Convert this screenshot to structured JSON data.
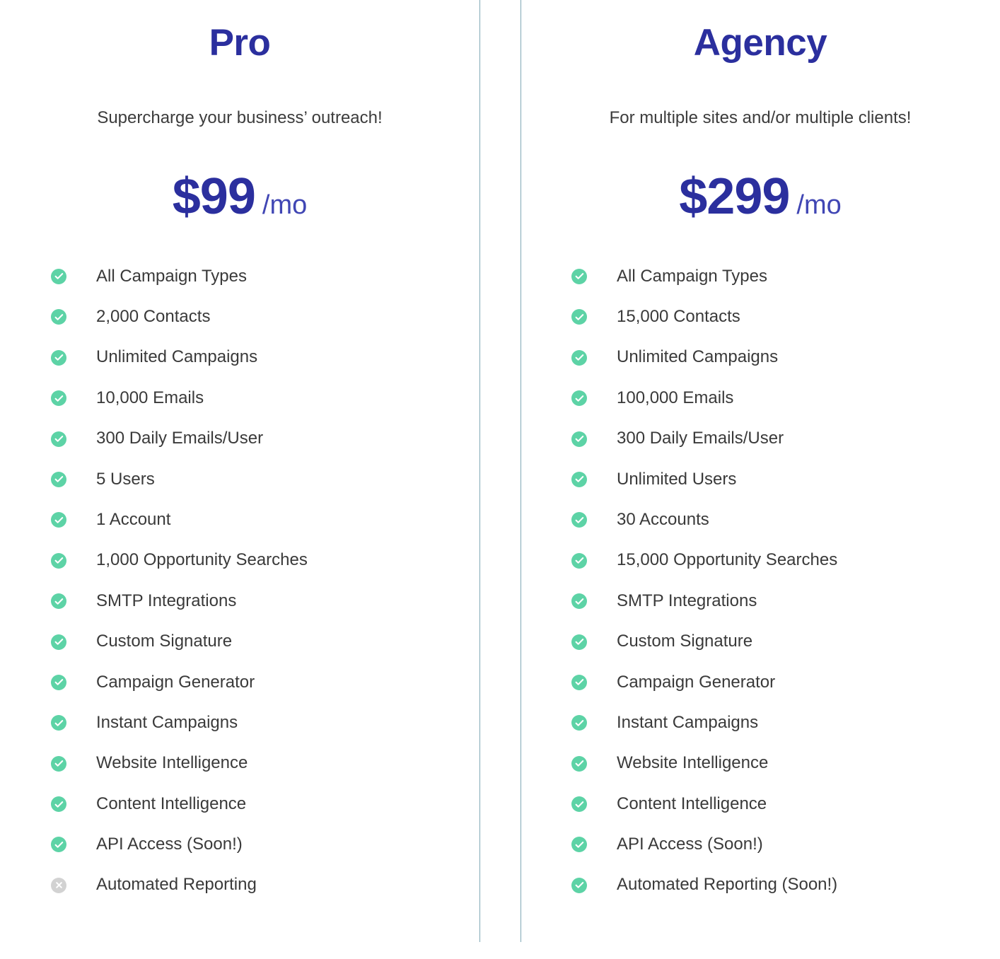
{
  "colors": {
    "title": "#2b2f9e",
    "price": "#2b2f9e",
    "period": "#4046b4",
    "feature_text": "#3a3a3a",
    "check_circle": "#5dd3a6",
    "cross_circle": "#d2d2d2",
    "divider": "#7fa8b5",
    "background": "#ffffff"
  },
  "plans": [
    {
      "name": "Pro",
      "tagline": "Supercharge your business’ outreach!",
      "price": "$99",
      "period": "/mo",
      "features": [
        {
          "label": "All Campaign Types",
          "included": true,
          "icon": "check-circle-icon"
        },
        {
          "label": "2,000 Contacts",
          "included": true,
          "icon": "check-circle-icon"
        },
        {
          "label": "Unlimited Campaigns",
          "included": true,
          "icon": "check-circle-icon"
        },
        {
          "label": "10,000 Emails",
          "included": true,
          "icon": "check-circle-icon"
        },
        {
          "label": "300 Daily Emails/User",
          "included": true,
          "icon": "check-circle-icon"
        },
        {
          "label": "5 Users",
          "included": true,
          "icon": "check-circle-icon"
        },
        {
          "label": "1 Account",
          "included": true,
          "icon": "check-circle-icon"
        },
        {
          "label": "1,000 Opportunity Searches",
          "included": true,
          "icon": "check-circle-icon"
        },
        {
          "label": "SMTP Integrations",
          "included": true,
          "icon": "check-circle-icon"
        },
        {
          "label": "Custom Signature",
          "included": true,
          "icon": "check-circle-icon"
        },
        {
          "label": "Campaign Generator",
          "included": true,
          "icon": "check-circle-icon"
        },
        {
          "label": "Instant Campaigns",
          "included": true,
          "icon": "check-circle-icon"
        },
        {
          "label": "Website Intelligence",
          "included": true,
          "icon": "check-circle-icon"
        },
        {
          "label": "Content Intelligence",
          "included": true,
          "icon": "check-circle-icon"
        },
        {
          "label": "API Access (Soon!)",
          "included": true,
          "icon": "check-circle-icon"
        },
        {
          "label": "Automated Reporting",
          "included": false,
          "icon": "cross-circle-icon"
        }
      ]
    },
    {
      "name": "Agency",
      "tagline": "For multiple sites and/or multiple clients!",
      "price": "$299",
      "period": "/mo",
      "features": [
        {
          "label": "All Campaign Types",
          "included": true,
          "icon": "check-circle-icon"
        },
        {
          "label": "15,000 Contacts",
          "included": true,
          "icon": "check-circle-icon"
        },
        {
          "label": "Unlimited Campaigns",
          "included": true,
          "icon": "check-circle-icon"
        },
        {
          "label": "100,000 Emails",
          "included": true,
          "icon": "check-circle-icon"
        },
        {
          "label": "300 Daily Emails/User",
          "included": true,
          "icon": "check-circle-icon"
        },
        {
          "label": "Unlimited Users",
          "included": true,
          "icon": "check-circle-icon"
        },
        {
          "label": "30 Accounts",
          "included": true,
          "icon": "check-circle-icon"
        },
        {
          "label": "15,000 Opportunity Searches",
          "included": true,
          "icon": "check-circle-icon"
        },
        {
          "label": "SMTP Integrations",
          "included": true,
          "icon": "check-circle-icon"
        },
        {
          "label": "Custom Signature",
          "included": true,
          "icon": "check-circle-icon"
        },
        {
          "label": "Campaign Generator",
          "included": true,
          "icon": "check-circle-icon"
        },
        {
          "label": "Instant Campaigns",
          "included": true,
          "icon": "check-circle-icon"
        },
        {
          "label": "Website Intelligence",
          "included": true,
          "icon": "check-circle-icon"
        },
        {
          "label": "Content Intelligence",
          "included": true,
          "icon": "check-circle-icon"
        },
        {
          "label": "API Access (Soon!)",
          "included": true,
          "icon": "check-circle-icon"
        },
        {
          "label": "Automated Reporting (Soon!)",
          "included": true,
          "icon": "check-circle-icon"
        }
      ]
    }
  ]
}
